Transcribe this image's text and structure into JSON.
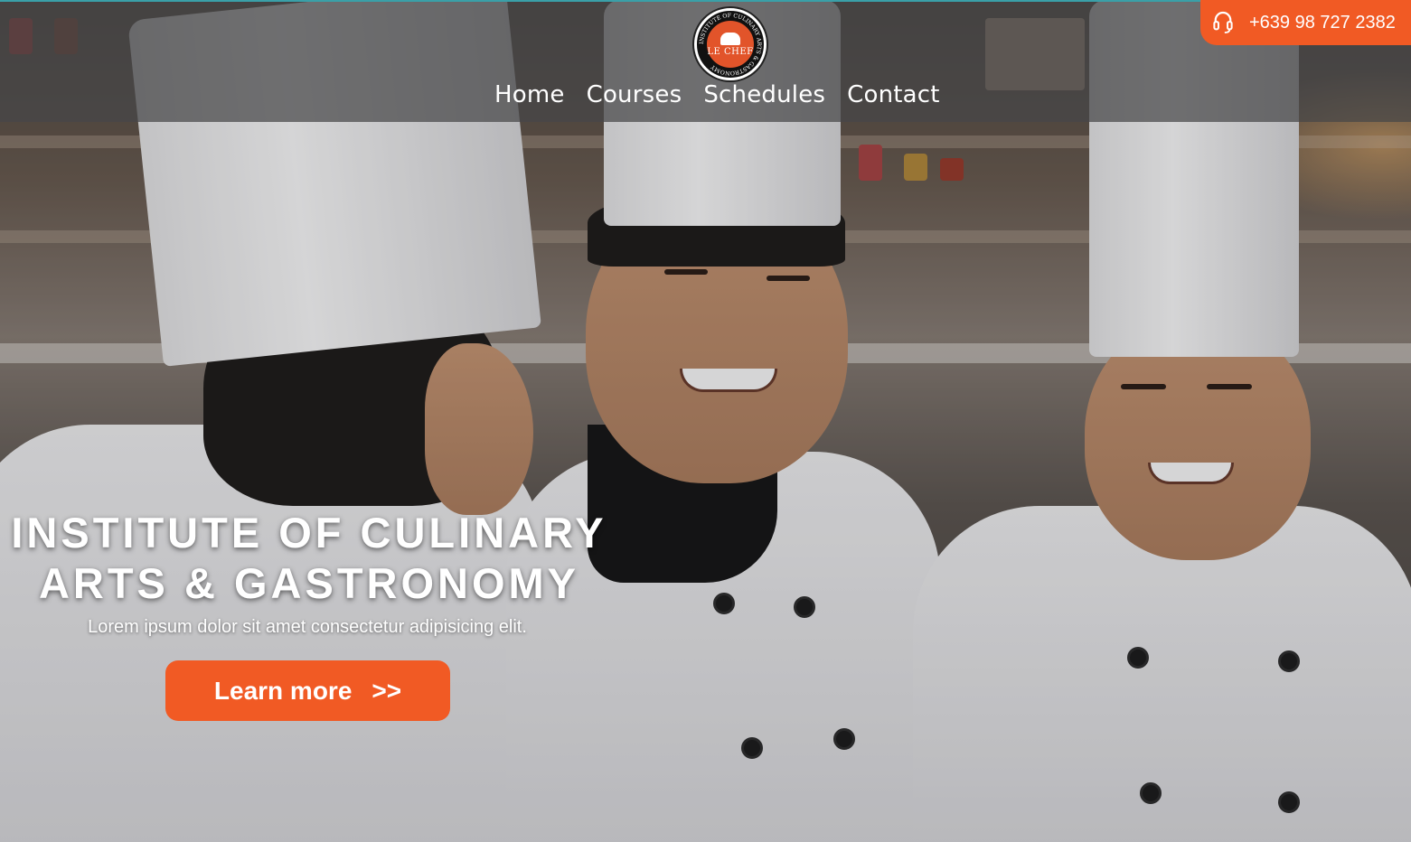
{
  "header": {
    "logo": {
      "ring_text": "INSTITUTE OF CULINARY ARTS & GASTRONOMY",
      "center_text": "LE CHEF"
    },
    "nav": [
      {
        "label": "Home"
      },
      {
        "label": "Courses"
      },
      {
        "label": "Schedules"
      },
      {
        "label": "Contact"
      }
    ],
    "phone": {
      "icon": "headset-icon",
      "number": "+639 98 727 2382"
    }
  },
  "hero": {
    "title_line1": "INSTITUTE OF CULINARY",
    "title_line2": "ARTS & GASTRONOMY",
    "subtitle": "Lorem ipsum dolor sit amet consectetur adipisicing elit.",
    "cta": {
      "label": "Learn more",
      "arrow": ">>"
    }
  },
  "colors": {
    "accent": "#f15a24",
    "header_bg": "#464648",
    "text": "#ffffff"
  }
}
